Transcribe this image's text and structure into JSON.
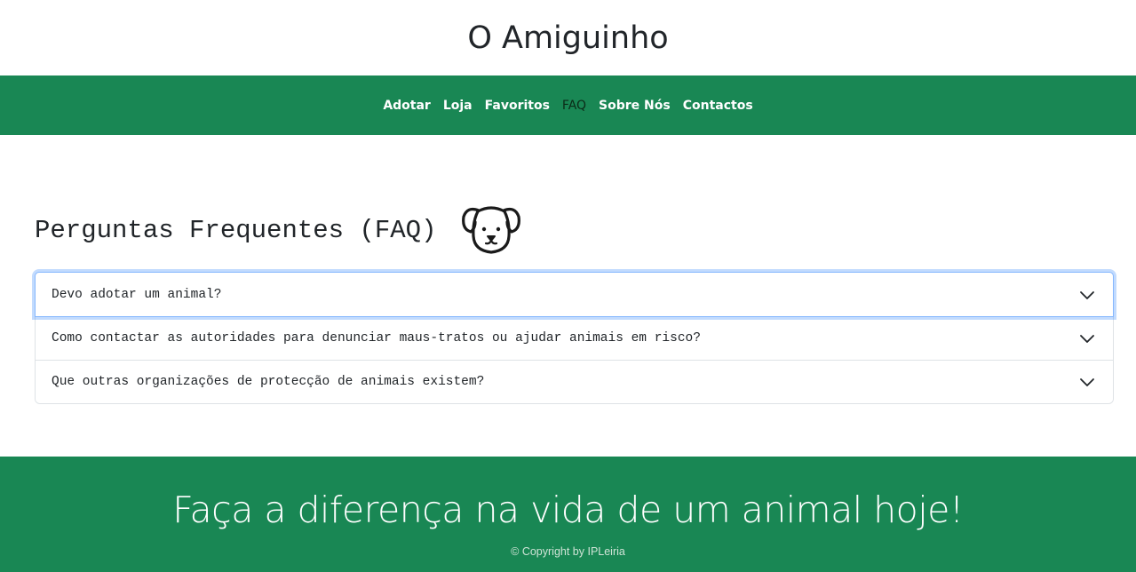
{
  "colors": {
    "brand": "#198754",
    "active_link": "#0b2a17",
    "focus_ring": "#86b7fe"
  },
  "header": {
    "title": "O Amiguinho"
  },
  "nav": {
    "items": [
      {
        "label": "Adotar"
      },
      {
        "label": "Loja"
      },
      {
        "label": "Favoritos"
      },
      {
        "label": "FAQ",
        "active": true
      },
      {
        "label": "Sobre Nós"
      },
      {
        "label": "Contactos"
      }
    ]
  },
  "faq": {
    "title": "Perguntas Frequentes (FAQ)",
    "icon": "dog-face-icon",
    "questions": [
      {
        "text": "Devo adotar um animal?",
        "icon": "chevron-down-icon",
        "focused": true
      },
      {
        "text": "Como contactar as autoridades para denunciar maus-tratos ou ajudar animais em risco?",
        "icon": "chevron-down-icon"
      },
      {
        "text": "Que outras organizações de protecção de animais existem?",
        "icon": "chevron-down-icon"
      }
    ]
  },
  "footer": {
    "slogan": "Faça a diferença na vida de um animal hoje!",
    "copyright": "© Copyright by IPLeiria"
  }
}
